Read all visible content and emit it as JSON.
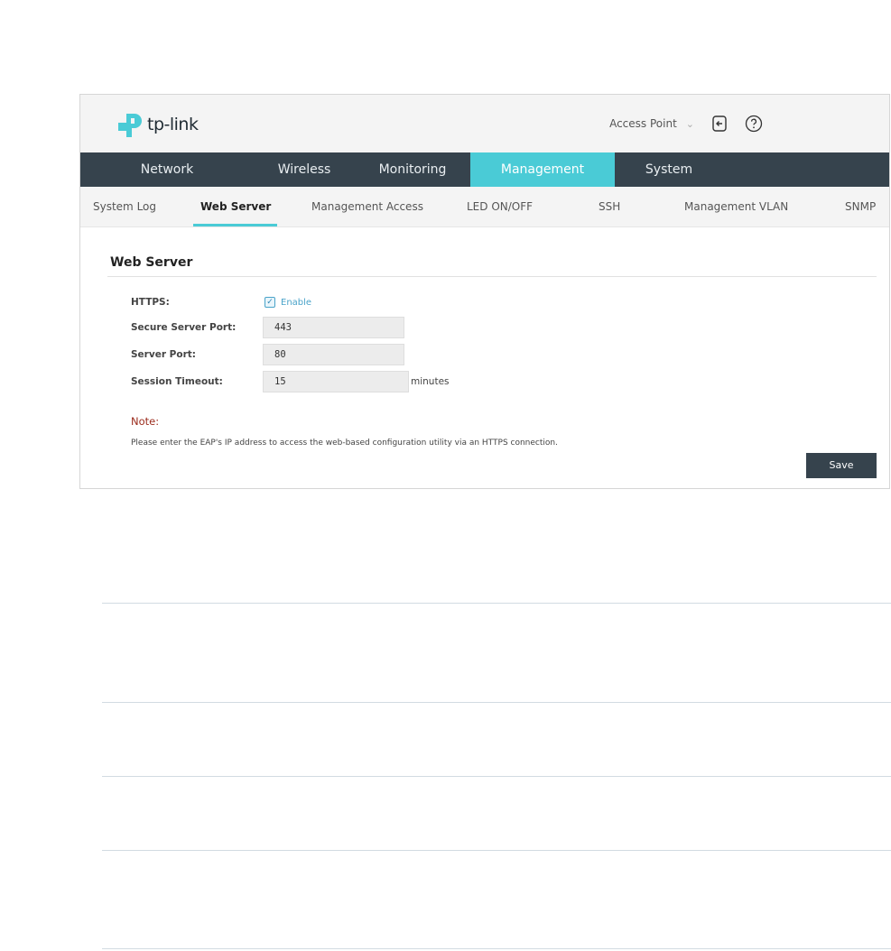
{
  "header": {
    "logo_text": "tp-link",
    "device_mode": "Access Point",
    "icons": [
      "logout-icon",
      "help-icon"
    ]
  },
  "main_nav": [
    {
      "label": "Network",
      "active": false
    },
    {
      "label": "Wireless",
      "active": false
    },
    {
      "label": "Monitoring",
      "active": false
    },
    {
      "label": "Management",
      "active": true
    },
    {
      "label": "System",
      "active": false
    }
  ],
  "sub_nav": [
    {
      "label": "System Log",
      "active": false
    },
    {
      "label": "Web Server",
      "active": true
    },
    {
      "label": "Management Access",
      "active": false
    },
    {
      "label": "LED ON/OFF",
      "active": false
    },
    {
      "label": "SSH",
      "active": false
    },
    {
      "label": "Management VLAN",
      "active": false
    },
    {
      "label": "SNMP",
      "active": false
    }
  ],
  "section": {
    "title": "Web Server",
    "https_label": "HTTPS:",
    "https_enable_label": "Enable",
    "https_enabled": true,
    "secure_port_label": "Secure Server Port:",
    "secure_port_value": "443",
    "server_port_label": "Server Port:",
    "server_port_value": "80",
    "timeout_label": "Session Timeout:",
    "timeout_value": "15",
    "timeout_unit": "minutes",
    "note_title": "Note:",
    "note_text": "Please enter the EAP's IP address to access the web-based configuration utility via an HTTPS connection.",
    "save_label": "Save"
  },
  "colors": {
    "nav_bg": "#36434d",
    "accent": "#4acbd6",
    "note": "#9b2b1c"
  }
}
